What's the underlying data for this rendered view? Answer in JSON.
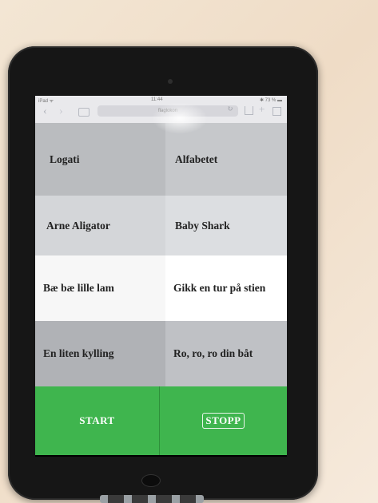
{
  "ios_bar": {
    "carrier": "iPad ᯤ",
    "time": "11:44",
    "battery": "✱ 73 % ▬",
    "url": "flaglokon"
  },
  "grid": {
    "cells": [
      {
        "label": "Logati",
        "color": "#babcbf"
      },
      {
        "label": "Alfabetet",
        "color": "#c6c8cb"
      },
      {
        "label": "Arne Aligator",
        "color": "#d4d6d9"
      },
      {
        "label": "Baby Shark",
        "color": "#dcdee1"
      },
      {
        "label": "Bæ bæ lille lam",
        "color": "#f7f7f7"
      },
      {
        "label": "Gikk en tur på stien",
        "color": "#ffffff"
      },
      {
        "label": "En liten kylling",
        "color": "#b0b2b6"
      },
      {
        "label": "Ro, ro, ro din båt",
        "color": "#bfc1c5"
      }
    ]
  },
  "controls": {
    "start_label": "START",
    "stop_label": "STOPP",
    "accent": "#3fb54e"
  },
  "icons": [
    "back-arrow-icon",
    "forward-arrow-icon",
    "bookmarks-icon",
    "reload-icon",
    "share-icon",
    "add-tab-icon",
    "tabs-icon"
  ]
}
